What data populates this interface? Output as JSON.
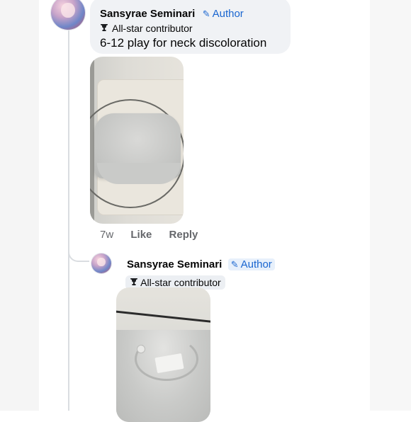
{
  "comment": {
    "author_name": "Sansyrae Seminari",
    "author_badge": "Author",
    "contributor_badge": "All-star contributor",
    "text": "6-12 play for neck discoloration",
    "time": "7w",
    "like_label": "Like",
    "reply_label": "Reply"
  },
  "reply": {
    "author_name": "Sansyrae Seminari",
    "author_badge": "Author",
    "contributor_badge": "All-star contributor"
  },
  "icons": {
    "pen": "✎",
    "trophy": "🏆"
  },
  "colors": {
    "author_blue": "#1a66d0",
    "bubble_bg": "#f0f2f5",
    "meta_gray": "#65676b"
  }
}
